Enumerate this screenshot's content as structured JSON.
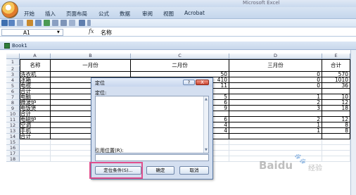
{
  "app": {
    "title": "Microsoft Excel"
  },
  "ribbon": {
    "tabs": [
      "开始",
      "插入",
      "页面布局",
      "公式",
      "数据",
      "审阅",
      "视图",
      "Acrobat"
    ]
  },
  "formula_bar": {
    "name_box": "A1",
    "fx": "fx",
    "formula": "名称"
  },
  "workbook": {
    "title": "Book1"
  },
  "sheet": {
    "columns": [
      "A",
      "B",
      "C",
      "D",
      "E"
    ],
    "row_numbers": [
      "1",
      "2",
      "3",
      "4",
      "5",
      "6",
      "7",
      "8",
      "9",
      "10",
      "11",
      "12",
      "13",
      "14",
      "15",
      "16",
      "17",
      "18"
    ],
    "header": {
      "name": "名称",
      "jan": "一月份",
      "feb": "二月份",
      "mar": "三月份",
      "total": "合计"
    },
    "rows": [
      {
        "name": "洗衣机",
        "b": "",
        "c": "50",
        "d": "0",
        "e": "570"
      },
      {
        "name": "冰箱",
        "b": "",
        "c": "410",
        "d": "0",
        "e": "1010"
      },
      {
        "name": "电视",
        "b": "",
        "c": "11",
        "d": "0",
        "e": "36"
      },
      {
        "name": "合计",
        "b": "",
        "c": "",
        "d": "",
        "e": ""
      },
      {
        "name": "电脑",
        "b": "",
        "c": "5",
        "d": "1",
        "e": "10"
      },
      {
        "name": "微波炉",
        "b": "",
        "c": "6",
        "d": "2",
        "e": "12"
      },
      {
        "name": "电饭煲",
        "b": "",
        "c": "9",
        "d": "3",
        "e": "18"
      },
      {
        "name": "合计",
        "b": "",
        "c": "",
        "d": "",
        "e": ""
      },
      {
        "name": "电磁炉",
        "b": "",
        "c": "6",
        "d": "2",
        "e": "12"
      },
      {
        "name": "空调",
        "b": "",
        "c": "4",
        "d": "1",
        "e": "8"
      },
      {
        "name": "手机",
        "b": "",
        "c": "4",
        "d": "1",
        "e": "8"
      },
      {
        "name": "合计",
        "b": "",
        "c": "",
        "d": "",
        "e": ""
      }
    ]
  },
  "dialog": {
    "title": "定位",
    "help": "?",
    "close": "X",
    "goto_label": "定位:",
    "reference_label": "引用位置(R):",
    "reference_value": "",
    "special_button": "定位条件(S)...",
    "ok_button": "确定",
    "cancel_button": "取消"
  },
  "watermark": {
    "text": "Baidu",
    "suffix": "经验"
  },
  "colors": {
    "highlight": "#e04e8c",
    "ribbon": "#c4d6ec",
    "dialog_bg": "#d4dff0"
  }
}
